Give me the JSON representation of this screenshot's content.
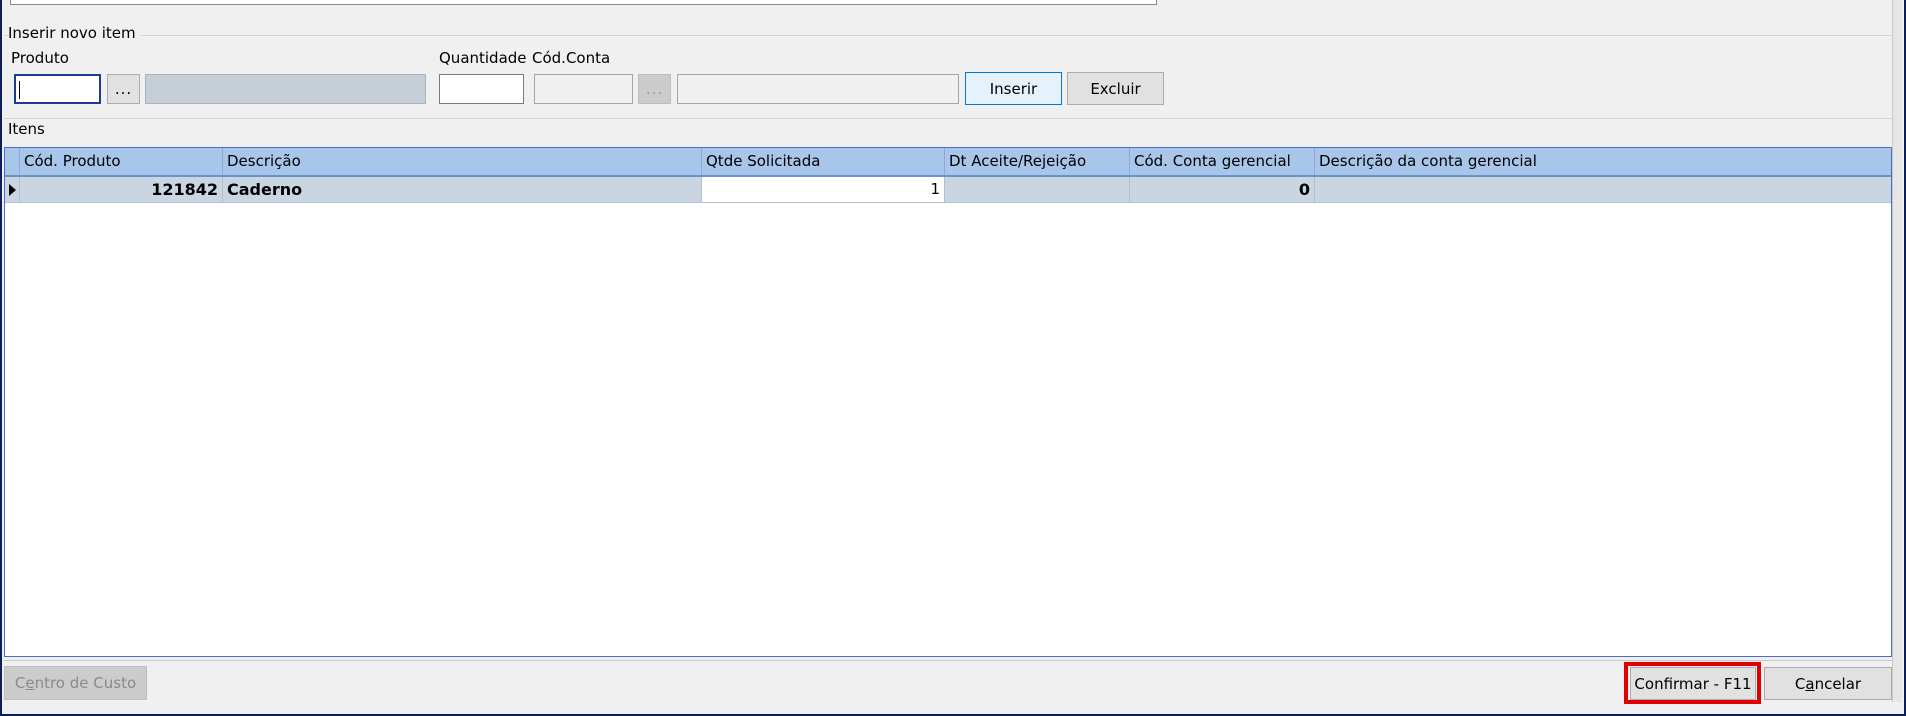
{
  "insert_group": {
    "title": "Inserir novo item",
    "produto_label": "Produto",
    "quantidade_label": "Quantidade",
    "cod_conta_label": "Cód.Conta",
    "produto_value": "",
    "produto_desc": "",
    "quantidade_value": "",
    "cod_conta_value": "",
    "conta_desc": "",
    "lookup_label": "...",
    "inserir_label": "Inserir",
    "excluir_label": "Excluir"
  },
  "items_group": {
    "title": "Itens",
    "columns": [
      "Cód. Produto",
      "Descrição",
      "Qtde Solicitada",
      "Dt Aceite/Rejeição",
      "Cód. Conta gerencial",
      "Descrição da conta gerencial"
    ],
    "rows": [
      {
        "cod_produto": "121842",
        "descricao": "Caderno",
        "qtde": "1",
        "dt_aceite": "",
        "cod_conta": "0",
        "desc_conta": ""
      }
    ]
  },
  "footer": {
    "centro_pre": "C",
    "centro_acc": "e",
    "centro_post": "ntro de Custo",
    "confirmar_label": "Confirmar - F11",
    "cancelar_pre": "C",
    "cancelar_acc": "a",
    "cancelar_post": "ncelar",
    "highlight_color": "#e00000"
  }
}
